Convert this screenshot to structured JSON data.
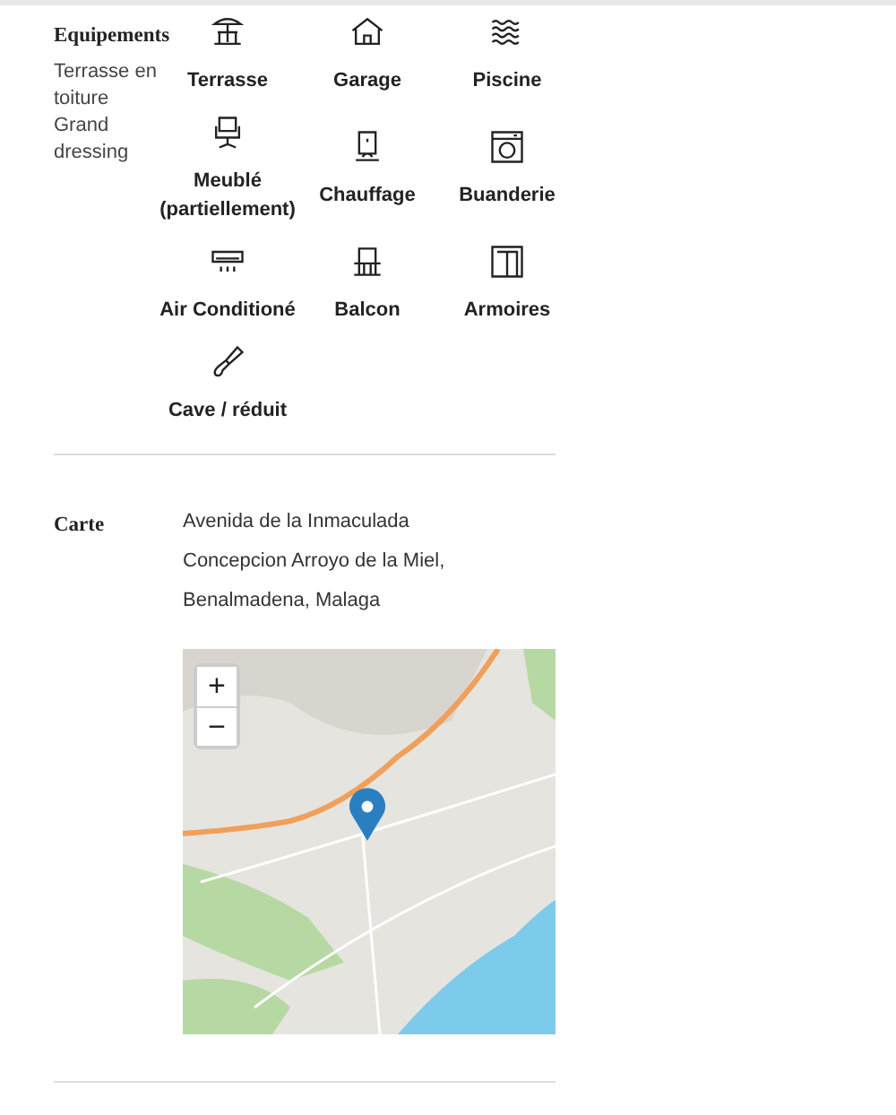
{
  "equipements": {
    "title": "Equipements",
    "extras": [
      "Terrasse en toiture",
      "Grand dressing"
    ],
    "items": [
      {
        "label": "Terrasse"
      },
      {
        "label": "Garage"
      },
      {
        "label": "Piscine"
      },
      {
        "label": "Meublé (partiellement)"
      },
      {
        "label": "Chauffage"
      },
      {
        "label": "Buanderie"
      },
      {
        "label": "Air Conditioné"
      },
      {
        "label": "Balcon"
      },
      {
        "label": "Armoires"
      },
      {
        "label": "Cave / réduit"
      }
    ]
  },
  "carte": {
    "title": "Carte",
    "address": [
      "Avenida de la Inmaculada",
      "Concepcion Arroyo de la Miel,",
      "Benalmadena, Malaga"
    ],
    "map": {
      "zoom_in": "+",
      "zoom_out": "−"
    }
  }
}
